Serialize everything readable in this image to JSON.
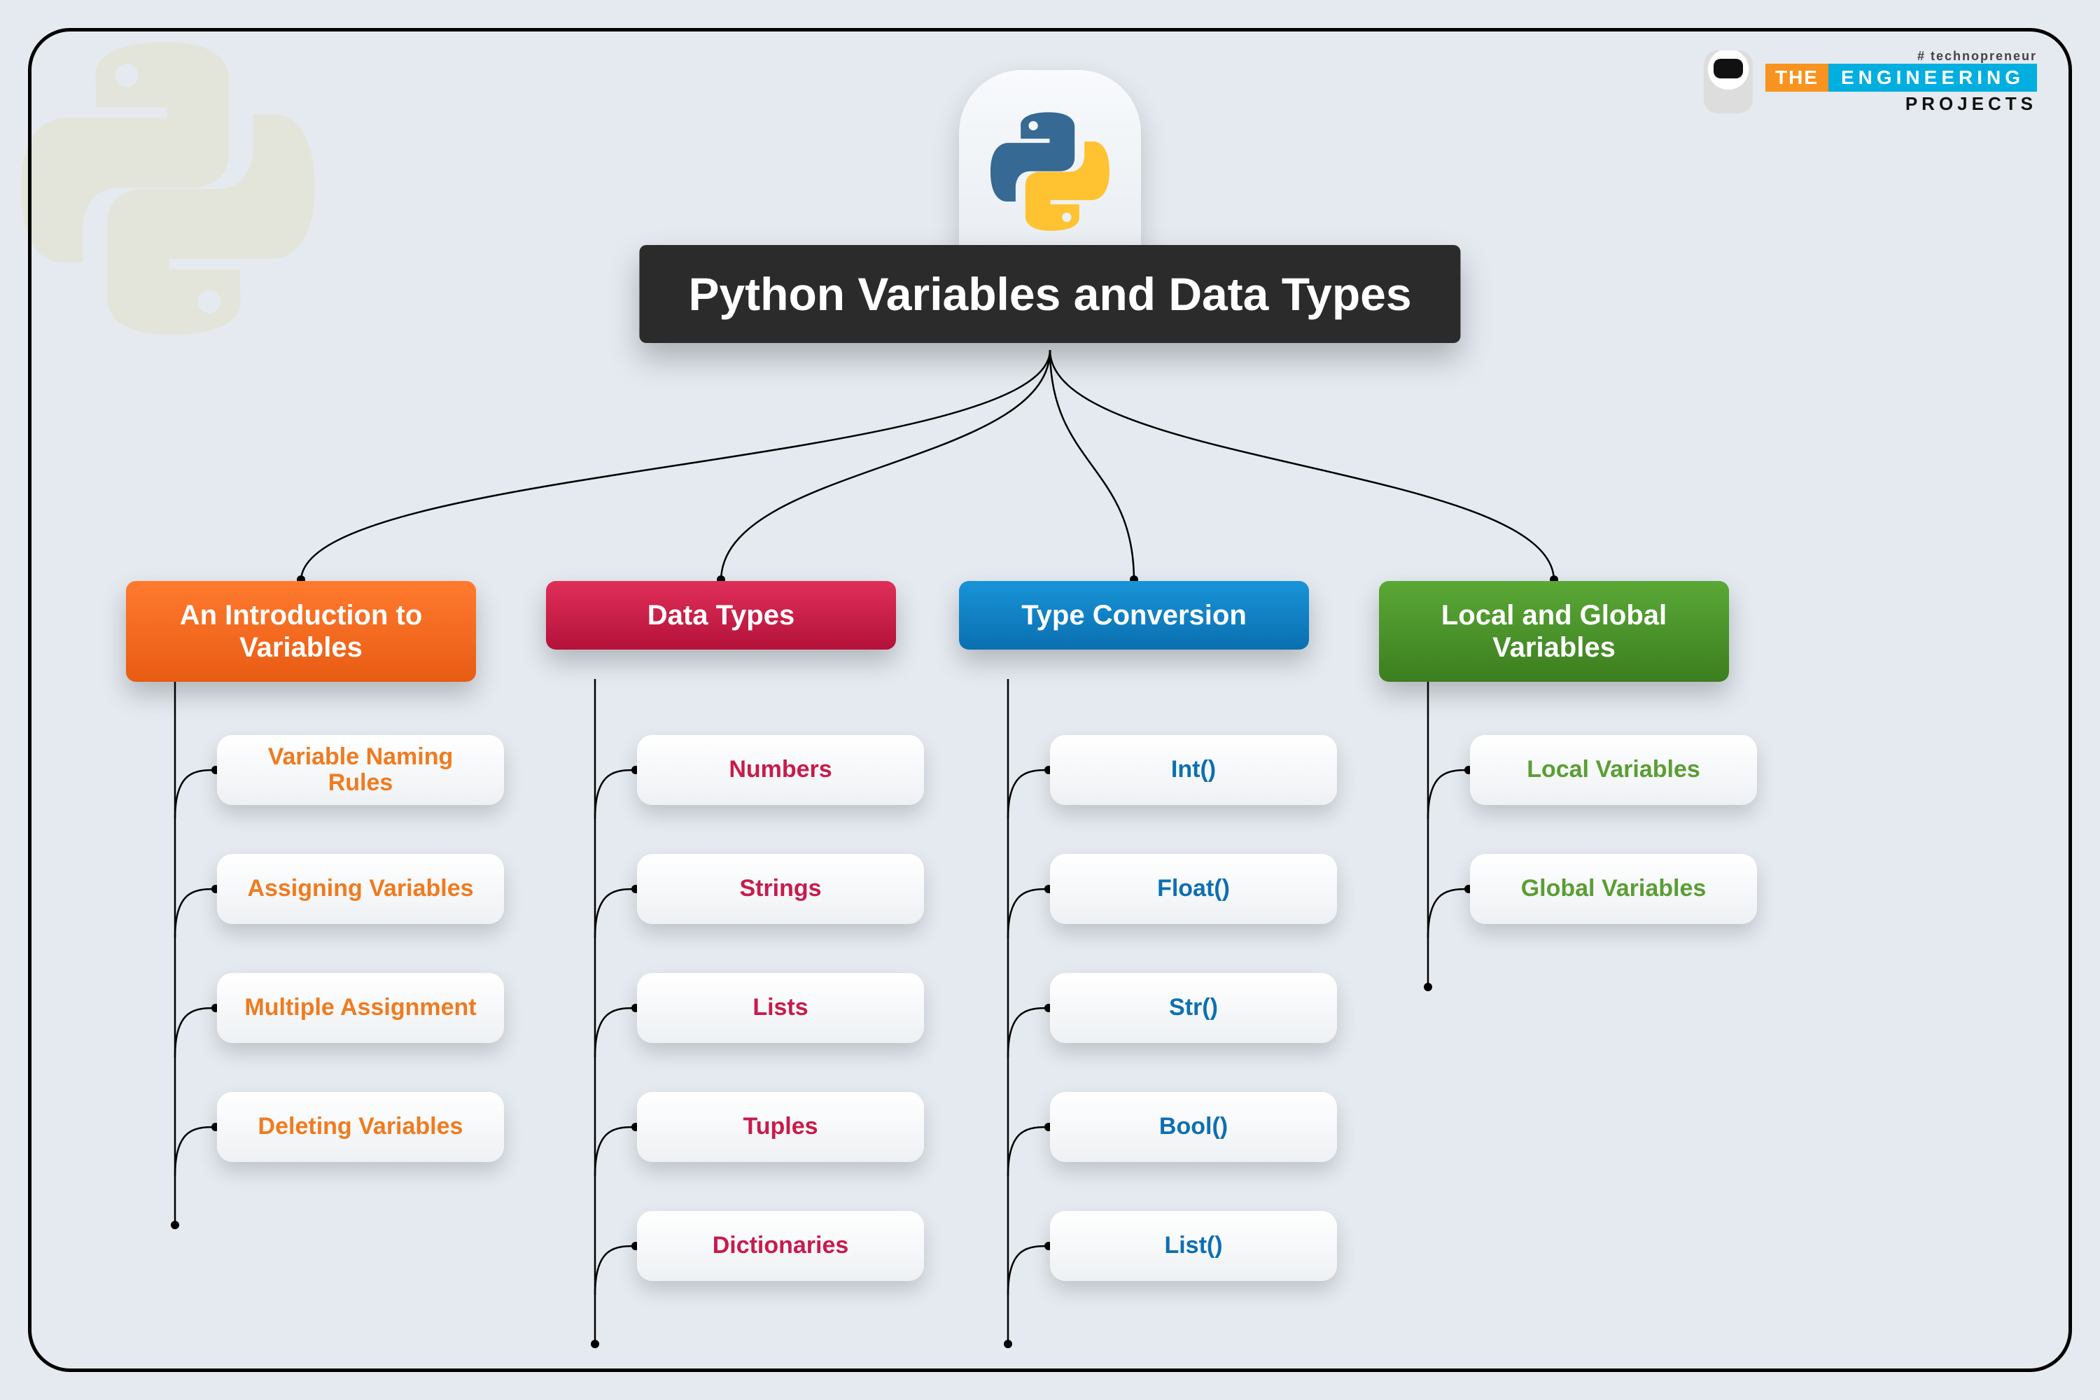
{
  "title": "Python Variables and Data Types",
  "brand": {
    "hash": "# technopreneur",
    "the": "THE",
    "eng": "ENGINEERING",
    "proj": "PROJECTS"
  },
  "categories": [
    {
      "label": "An Introduction to Variables",
      "color": "orange",
      "items": [
        "Variable Naming Rules",
        "Assigning Variables",
        "Multiple Assignment",
        "Deleting Variables"
      ]
    },
    {
      "label": "Data Types",
      "color": "red",
      "items": [
        "Numbers",
        "Strings",
        "Lists",
        "Tuples",
        "Dictionaries"
      ]
    },
    {
      "label": "Type Conversion",
      "color": "blue",
      "items": [
        "Int()",
        "Float()",
        "Str()",
        "Bool()",
        "List()"
      ]
    },
    {
      "label": "Local and Global Variables",
      "color": "green",
      "items": [
        "Local Variables",
        "Global Variables"
      ]
    }
  ],
  "layout": {
    "titleBottomY": 500,
    "catY": 830,
    "catCenters": [
      430,
      1030,
      1620,
      2220
    ],
    "catHeight": 140,
    "pillStartY": 1050,
    "pillGap": 170,
    "pillOffsetX": 150
  }
}
